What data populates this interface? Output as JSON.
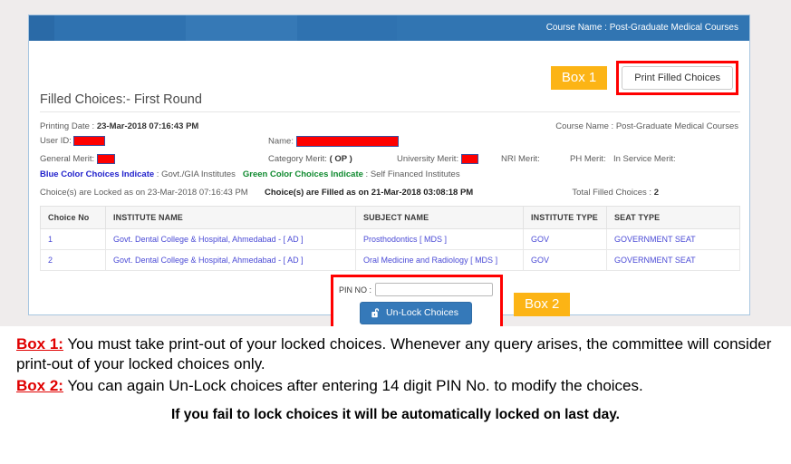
{
  "navbar": {
    "course_name": "Course Name : Post-Graduate Medical Courses"
  },
  "toolbar": {
    "box1_tag": "Box 1",
    "print_filled_choices_label": "Print Filled Choices"
  },
  "page": {
    "title": "Filled Choices:- First Round"
  },
  "info": {
    "printing_date_label": "Printing Date :",
    "printing_date_value": "23-Mar-2018 07:16:43 PM",
    "course_name_label": "Course Name :",
    "course_name_value": "Post-Graduate Medical Courses",
    "user_id_label": "User ID:",
    "name_label": "Name:",
    "general_merit_label": "General Merit:",
    "category_merit_label": "Category Merit:",
    "category_merit_value": "( OP )",
    "university_merit_label": "University Merit:",
    "nri_merit_label": "NRI Merit:",
    "ph_merit_label": "PH Merit:",
    "in_service_merit_label": "In Service Merit:"
  },
  "legend": {
    "blue_label": "Blue Color Choices Indicate",
    "blue_sep": " : ",
    "blue_value": "Govt./GIA Institutes",
    "green_label": "Green Color Choices Indicate",
    "green_sep": " : ",
    "green_value": "Self Financed Institutes"
  },
  "status": {
    "locked_text": "Choice(s) are Locked as on 23-Mar-2018 07:16:43 PM",
    "filled_text": "Choice(s) are Filled as on 21-Mar-2018 03:08:18 PM",
    "total_filled_label": "Total Filled Choices :",
    "total_filled_value": "2"
  },
  "table": {
    "headers": [
      "Choice No",
      "INSTITUTE NAME",
      "SUBJECT NAME",
      "INSTITUTE TYPE",
      "SEAT TYPE"
    ],
    "rows": [
      {
        "choice_no": "1",
        "institute_name": "Govt. Dental College & Hospital, Ahmedabad - [ AD ]",
        "subject_name": "Prosthodontics [ MDS ]",
        "institute_type": "GOV",
        "seat_type": "GOVERNMENT SEAT"
      },
      {
        "choice_no": "2",
        "institute_name": "Govt. Dental College & Hospital, Ahmedabad - [ AD ]",
        "subject_name": "Oral Medicine and Radiology [ MDS ]",
        "institute_type": "GOV",
        "seat_type": "GOVERNMENT SEAT"
      }
    ]
  },
  "pin": {
    "label": "PIN NO :",
    "value": "",
    "placeholder": "",
    "unlock_button_label": "Un-Lock Choices",
    "box2_tag": "Box 2"
  },
  "caption": {
    "box1_ref": "Box 1:",
    "box1_text": " You must take print-out of your locked choices. Whenever any query arises, the committee will consider print-out of your locked choices only.",
    "box2_ref": "Box 2:",
    "box2_text": " You can again Un-Lock choices after entering 14 digit PIN No. to modify the choices.",
    "footer": "If you fail to lock choices it will be automatically locked on last day."
  },
  "colors": {
    "navbar_blue": "#2f72b0",
    "accent_orange": "#fcb415",
    "highlight_red": "#ff0000",
    "table_link_blue": "#4b4bd6",
    "legend_green": "#0f8a2f",
    "button_blue": "#3579b9"
  }
}
